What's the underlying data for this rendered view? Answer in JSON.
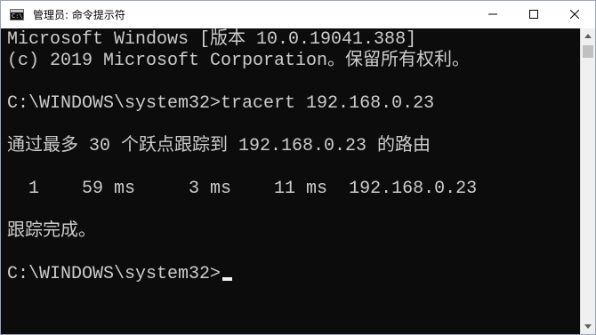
{
  "window": {
    "title": "管理员: 命令提示符",
    "icon": "command-prompt-icon",
    "icon_glyph": "C:\\_",
    "title_color": "#000000"
  },
  "controls": {
    "minimize": "minimize-icon",
    "maximize": "maximize-icon",
    "close": "close-icon"
  },
  "console": {
    "background": "#0c0c0c",
    "foreground": "#cccccc",
    "lines": [
      "Microsoft Windows [版本 10.0.19041.388]",
      "(c) 2019 Microsoft Corporation。保留所有权利。",
      "C:\\WINDOWS\\system32>tracert 192.168.0.23",
      "通过最多 30 个跃点跟踪到 192.168.0.23 的路由",
      "  1    59 ms     3 ms    11 ms  192.168.0.23",
      "跟踪完成。",
      "C:\\WINDOWS\\system32>"
    ]
  }
}
